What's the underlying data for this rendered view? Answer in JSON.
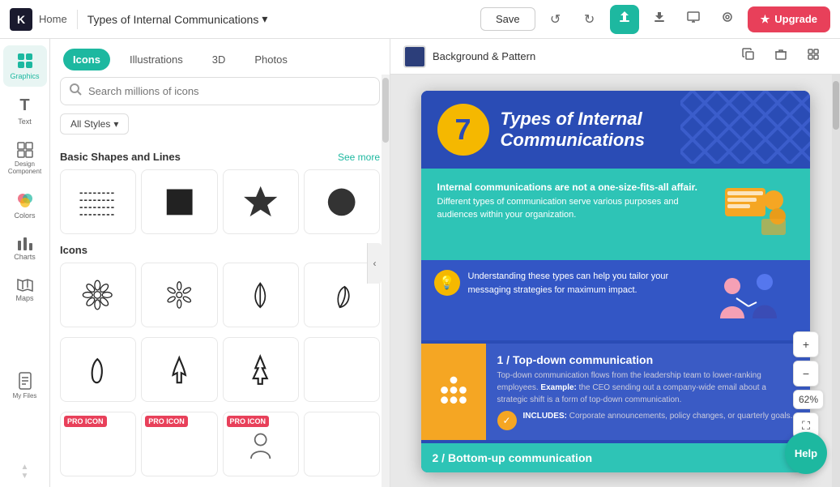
{
  "topbar": {
    "logo": "K",
    "home_label": "Home",
    "title": "Types of Internal Communications",
    "chevron": "▾",
    "save_label": "Save",
    "undo_icon": "↺",
    "redo_icon": "↻",
    "share_icon": "⬆",
    "download_icon": "⬇",
    "present_icon": "▶",
    "preview_icon": "👁",
    "upgrade_label": "Upgrade",
    "upgrade_icon": "★"
  },
  "left_nav": {
    "items": [
      {
        "id": "graphics",
        "label": "Graphics",
        "icon": "⬡",
        "active": true
      },
      {
        "id": "text",
        "label": "Text",
        "icon": "T"
      },
      {
        "id": "design",
        "label": "Design Component",
        "icon": "⊞"
      },
      {
        "id": "colors",
        "label": "Colors",
        "icon": "⬤"
      },
      {
        "id": "charts",
        "label": "Charts",
        "icon": "📊"
      },
      {
        "id": "maps",
        "label": "Maps",
        "icon": "🗺"
      },
      {
        "id": "files",
        "label": "My Files",
        "icon": "□"
      }
    ]
  },
  "panel": {
    "tabs": [
      {
        "id": "icons",
        "label": "Icons",
        "active": true
      },
      {
        "id": "illustrations",
        "label": "Illustrations",
        "active": false
      },
      {
        "id": "3d",
        "label": "3D",
        "active": false
      },
      {
        "id": "photos",
        "label": "Photos",
        "active": false
      }
    ],
    "search_placeholder": "Search millions of icons",
    "filter_label": "All Styles",
    "filter_chevron": "▾",
    "basic_shapes_section": "Basic Shapes and Lines",
    "see_more_label": "See more",
    "icons_section": "Icons"
  },
  "canvas": {
    "bg_pattern_label": "Background & Pattern",
    "bg_color": "#2c3e7a"
  },
  "right_controls": {
    "zoom_plus": "+",
    "zoom_minus": "−",
    "zoom_value": "62%",
    "fullscreen_icon": "⛶"
  },
  "help_label": "Help",
  "infographic": {
    "number": "7",
    "title": "Types of Internal\nCommunications",
    "desc": "Internal communications are not a one-size-fits-all affair. Different types of communication serve various purposes and audiences within your organization.",
    "tip": "Understanding these types can help you tailor your messaging strategies for maximum impact.",
    "section1_title": "1 / Top-down communication",
    "section1_body": "Top-down communication flows from the leadership team to lower-ranking employees.",
    "section1_example": "Example",
    "section1_example_text": ": the CEO sending out a company-wide email about a strategic shift is a form of top-down communication.",
    "section1_includes_label": "INCLUDES:",
    "section1_includes_text": "Corporate announcements, policy changes, or quarterly goals.",
    "section2_title": "2 / Bottom-up communication"
  }
}
